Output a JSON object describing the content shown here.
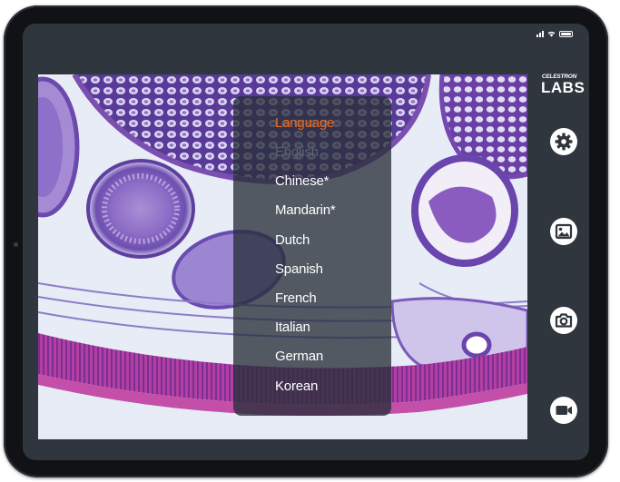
{
  "status_bar": {
    "icons": [
      "cellular-signal-icon",
      "wifi-icon",
      "battery-icon"
    ]
  },
  "language_menu": {
    "title": "Language",
    "items": [
      {
        "label": "English",
        "selected": true
      },
      {
        "label": "Chinese*",
        "selected": false
      },
      {
        "label": "Mandarin*",
        "selected": false
      },
      {
        "label": "Dutch",
        "selected": false
      },
      {
        "label": "Spanish",
        "selected": false
      },
      {
        "label": "French",
        "selected": false
      },
      {
        "label": "Italian",
        "selected": false
      },
      {
        "label": "German",
        "selected": false
      },
      {
        "label": "Korean",
        "selected": false
      }
    ]
  },
  "logo": {
    "brand": "CELESTRON",
    "product": "LABS"
  },
  "sidebar": {
    "buttons": [
      {
        "icon": "gear-icon",
        "label": "Settings"
      },
      {
        "icon": "gallery-icon",
        "label": "Gallery"
      },
      {
        "icon": "camera-icon",
        "label": "Photo"
      },
      {
        "icon": "video-camera-icon",
        "label": "Video"
      }
    ]
  },
  "colors": {
    "accent": "#f06a1c",
    "screen_bg": "#2f363d",
    "device_frame": "#101216",
    "specimen_purple": "#7a4fb0",
    "specimen_magenta": "#c0389e"
  }
}
